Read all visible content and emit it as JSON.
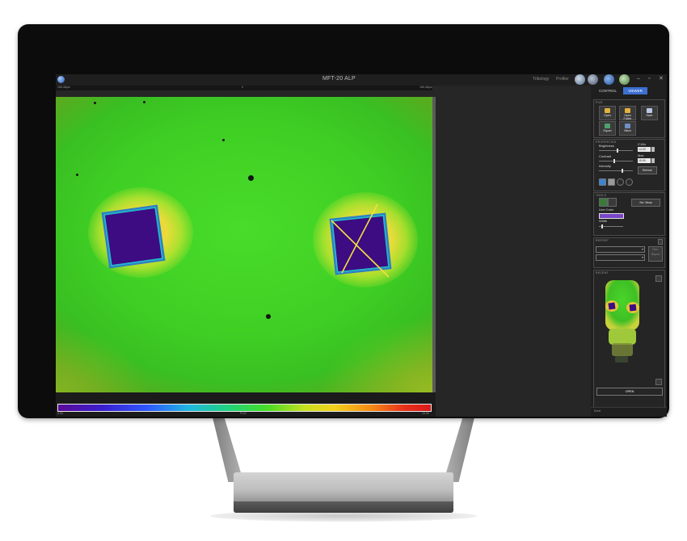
{
  "window": {
    "title": "MFT-20 ALP",
    "modes": [
      "Tribology",
      "Profiler"
    ]
  },
  "ruler": {
    "left": "165.48µm",
    "center": "0",
    "right": "165.48µm"
  },
  "colorbar": {
    "min": "0.00",
    "center": "FLAT",
    "max": "15.09"
  },
  "panel": {
    "tabs": [
      "CONTROL",
      "VIEWER"
    ],
    "file": {
      "header": "FILE",
      "buttons": [
        "Open",
        "Open Folder",
        "Save",
        "Export",
        "Stitch"
      ]
    },
    "properties": {
      "header": "PROPERTIES",
      "brightness": "Brightness",
      "contrast": "Contrast",
      "intensity": "Intensity",
      "zmin_label": "Z Min",
      "zmin": "14.03",
      "zmax_label": "Max",
      "zmax": "15.09",
      "refresh": "Refresh",
      "brightness_level": 0.55,
      "contrast_level": 0.45,
      "intensity_level": 0.7
    },
    "tools": {
      "header": "TOOLS",
      "lock": "Sel. Meas",
      "line_color": "Line Color",
      "width": "Width",
      "line_color_value": "#7a46c8"
    },
    "report": {
      "header": "REPORT",
      "action": "Gen. Report"
    },
    "recent": {
      "header": "RECENT",
      "open": "OPEN"
    },
    "status": "Done"
  }
}
